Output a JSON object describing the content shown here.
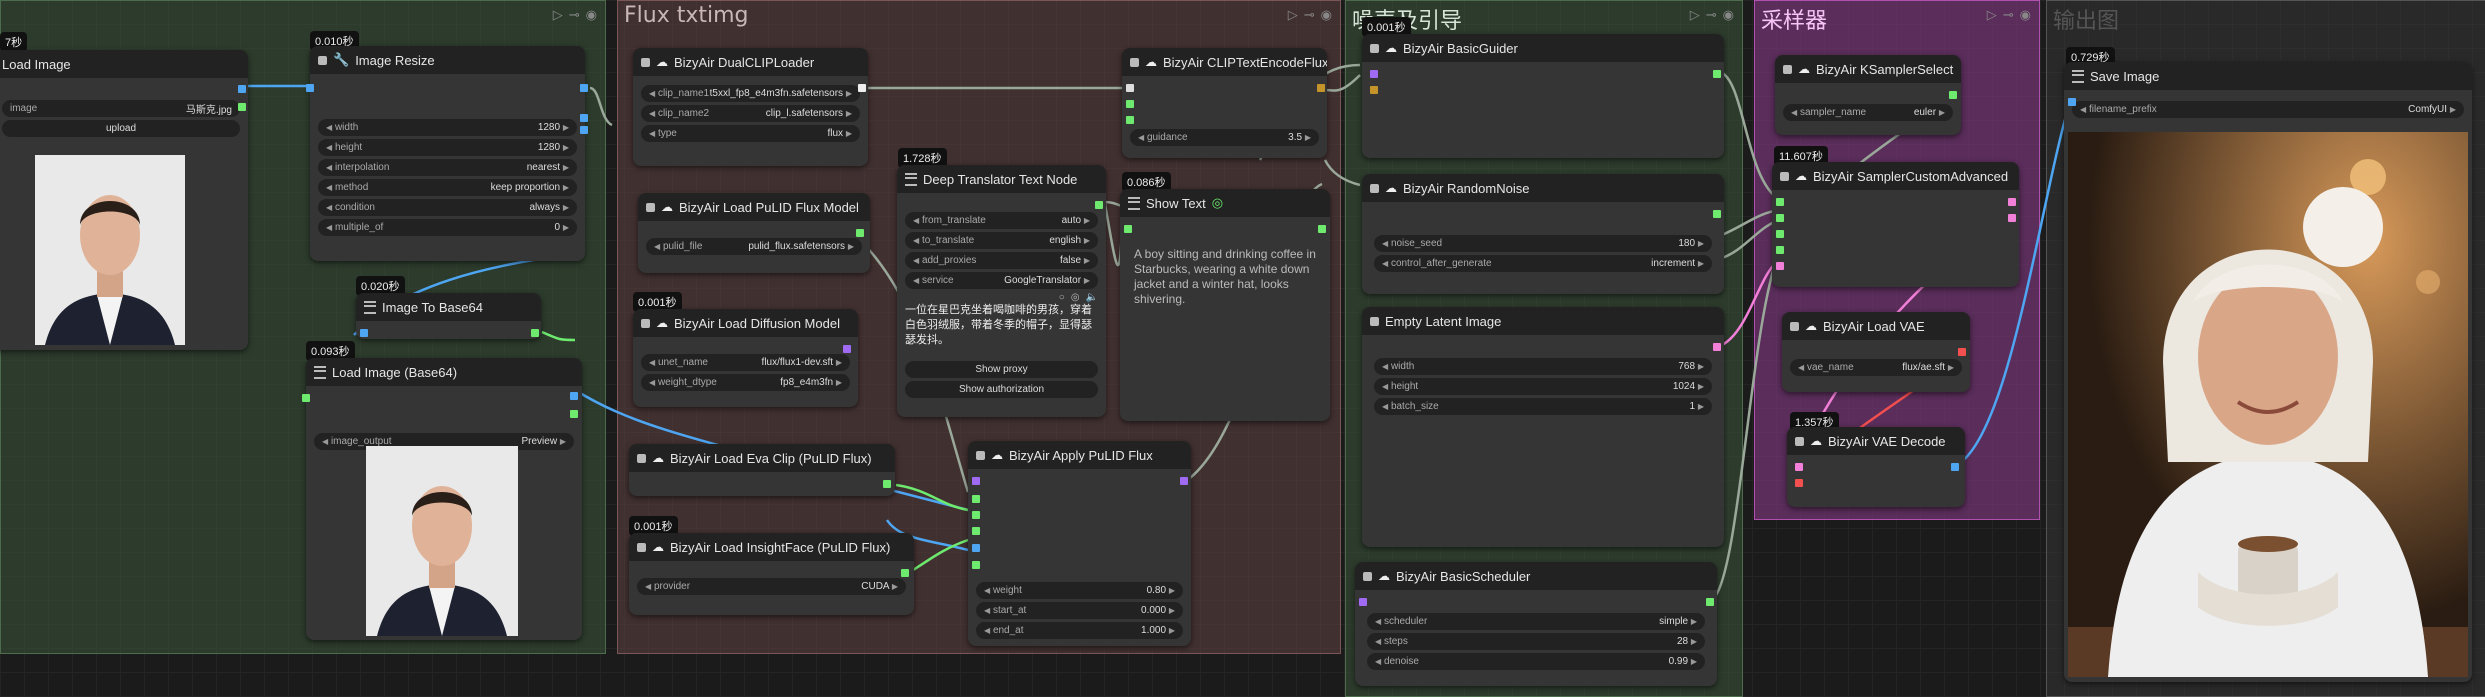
{
  "groups": {
    "g2_title": "Flux txtimg",
    "g3_title": "噪声及引导",
    "g4_title": "采样器",
    "g5_title": "输出图"
  },
  "nodes": {
    "load_image": {
      "time": "7秒",
      "title": "Load Image",
      "image_label": "image",
      "image_value": "马斯克.jpg",
      "upload": "upload"
    },
    "image_resize": {
      "time": "0.010秒",
      "title": "Image Resize",
      "widgets": [
        [
          "width",
          "1280"
        ],
        [
          "height",
          "1280"
        ],
        [
          "interpolation",
          "nearest"
        ],
        [
          "method",
          "keep proportion"
        ],
        [
          "condition",
          "always"
        ],
        [
          "multiple_of",
          "0"
        ]
      ]
    },
    "image_to_base64": {
      "time": "0.020秒",
      "title": "Image To Base64"
    },
    "load_image_base64": {
      "time": "0.093秒",
      "title": "Load Image (Base64)",
      "image_output": "image_output",
      "image_output_value": "Preview"
    },
    "dual_clip": {
      "title": "BizyAir DualCLIPLoader",
      "widgets": [
        [
          "clip_name1",
          "t5xxl_fp8_e4m3fn.safetensors"
        ],
        [
          "clip_name2",
          "clip_l.safetensors"
        ],
        [
          "type",
          "flux"
        ]
      ]
    },
    "pulid_model": {
      "title": "BizyAir Load PuLID Flux Model",
      "widgets": [
        [
          "pulid_file",
          "pulid_flux.safetensors"
        ]
      ]
    },
    "diffusion_model": {
      "time": "0.001秒",
      "title": "BizyAir Load Diffusion Model",
      "widgets": [
        [
          "unet_name",
          "flux/flux1-dev.sft"
        ],
        [
          "weight_dtype",
          "fp8_e4m3fn"
        ]
      ]
    },
    "eva_clip": {
      "title": "BizyAir Load Eva Clip (PuLID Flux)"
    },
    "insightface": {
      "time": "0.001秒",
      "title": "BizyAir Load InsightFace (PuLID Flux)",
      "widgets": [
        [
          "provider",
          "CUDA"
        ]
      ]
    },
    "translator": {
      "time": "1.728秒",
      "title": "Deep Translator Text Node",
      "widgets": [
        [
          "from_translate",
          "auto"
        ],
        [
          "to_translate",
          "english"
        ],
        [
          "add_proxies",
          "false"
        ],
        [
          "service",
          "GoogleTranslator"
        ]
      ],
      "text": "一位在星巴克坐着喝咖啡的男孩，穿着白色羽绒服，带着冬季的帽子，显得瑟瑟发抖。",
      "btn_proxy": "Show proxy",
      "btn_auth": "Show authorization"
    },
    "apply_pulid": {
      "title": "BizyAir Apply PuLID Flux",
      "widgets": [
        [
          "weight",
          "0.80"
        ],
        [
          "start_at",
          "0.000"
        ],
        [
          "end_at",
          "1.000"
        ]
      ]
    },
    "clip_encode": {
      "title": "BizyAir CLIPTextEncodeFlux",
      "widgets": [
        [
          "guidance",
          "3.5"
        ]
      ]
    },
    "show_text": {
      "time": "0.086秒",
      "title": "Show Text",
      "text": "A boy sitting and drinking coffee in Starbucks, wearing a white down jacket and a winter hat, looks shivering."
    },
    "basic_guider": {
      "time": "0.001秒",
      "title": "BizyAir BasicGuider"
    },
    "random_noise": {
      "title": "BizyAir RandomNoise",
      "widgets": [
        [
          "noise_seed",
          "180"
        ],
        [
          "control_after_generate",
          "increment"
        ]
      ]
    },
    "empty_latent": {
      "title": "Empty Latent Image",
      "widgets": [
        [
          "width",
          "768"
        ],
        [
          "height",
          "1024"
        ],
        [
          "batch_size",
          "1"
        ]
      ]
    },
    "basic_scheduler": {
      "title": "BizyAir BasicScheduler",
      "widgets": [
        [
          "scheduler",
          "simple"
        ],
        [
          "steps",
          "28"
        ],
        [
          "denoise",
          "0.99"
        ]
      ]
    },
    "ksampler_select": {
      "title": "BizyAir KSamplerSelect",
      "widgets": [
        [
          "sampler_name",
          "euler"
        ]
      ]
    },
    "sampler_custom": {
      "time": "11.607秒",
      "title": "BizyAir SamplerCustomAdvanced"
    },
    "load_vae": {
      "title": "BizyAir Load VAE",
      "widgets": [
        [
          "vae_name",
          "flux/ae.sft"
        ]
      ]
    },
    "vae_decode": {
      "time": "1.357秒",
      "title": "BizyAir VAE Decode"
    },
    "save_image": {
      "time": "0.729秒",
      "title": "Save Image",
      "widgets": [
        [
          "filename_prefix",
          "ComfyUI"
        ]
      ]
    }
  }
}
